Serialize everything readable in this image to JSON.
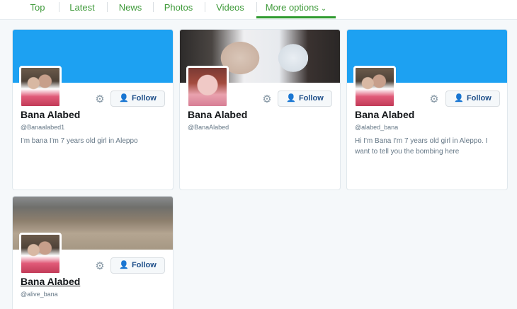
{
  "nav": {
    "tabs": [
      {
        "label": "Top"
      },
      {
        "label": "Latest"
      },
      {
        "label": "News"
      },
      {
        "label": "Photos"
      },
      {
        "label": "Videos"
      },
      {
        "label": "More options",
        "active": true
      }
    ]
  },
  "cards": [
    {
      "name": "Bana Alabed",
      "handle": "@Banaalabed1",
      "bio": "I'm bana I'm 7 years old girl in Aleppo",
      "follow_label": "Follow",
      "banner": "blue"
    },
    {
      "name": "Bana Alabed",
      "handle": "@BanaAlabed",
      "bio": "",
      "follow_label": "Follow",
      "banner": "photo"
    },
    {
      "name": "Bana Alabed",
      "handle": "@alabed_bana",
      "bio": "Hi I'm Bana I'm 7 years old girl in Aleppo. I want to tell you the bombing here",
      "follow_label": "Follow",
      "banner": "blue"
    },
    {
      "name": "Bana Alabed",
      "handle": "@alive_bana",
      "bio": "",
      "follow_label": "Follow",
      "banner": "photo"
    }
  ],
  "colors": {
    "accent": "#1da1f2",
    "nav_text": "#3f9a3a",
    "nav_active_bar": "#2f9a2f",
    "button_text": "#1d4e89"
  }
}
